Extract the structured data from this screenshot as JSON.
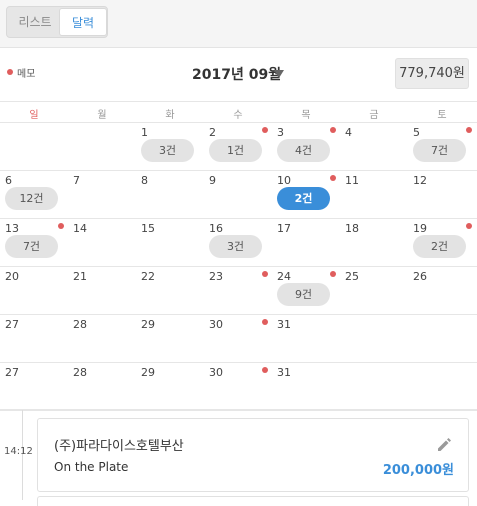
{
  "view_toggle": {
    "list_label": "리스트",
    "calendar_label": "달력"
  },
  "toolbar": {
    "memo_label": "메모",
    "month": "2017년 09월",
    "total": "779,740원",
    "memo_color": "#e05d5d",
    "accent_color": "#3a8ed9"
  },
  "weekdays": [
    "일",
    "월",
    "화",
    "수",
    "목",
    "금",
    "토"
  ],
  "calendar": {
    "weeks": [
      [
        {
          "day": "",
          "dot": false,
          "count": ""
        },
        {
          "day": "",
          "dot": false,
          "count": ""
        },
        {
          "day": "1",
          "dot": false,
          "count": "3건"
        },
        {
          "day": "2",
          "dot": true,
          "count": "1건"
        },
        {
          "day": "3",
          "dot": true,
          "count": "4건"
        },
        {
          "day": "4",
          "dot": false,
          "count": ""
        },
        {
          "day": "5",
          "dot": true,
          "count": "7건"
        }
      ],
      [
        {
          "day": "6",
          "dot": false,
          "count": "12건"
        },
        {
          "day": "7",
          "dot": false,
          "count": ""
        },
        {
          "day": "8",
          "dot": false,
          "count": ""
        },
        {
          "day": "9",
          "dot": false,
          "count": ""
        },
        {
          "day": "10",
          "dot": true,
          "count": "2건",
          "active": true
        },
        {
          "day": "11",
          "dot": false,
          "count": ""
        },
        {
          "day": "12",
          "dot": false,
          "count": ""
        }
      ],
      [
        {
          "day": "13",
          "dot": true,
          "count": "7건"
        },
        {
          "day": "14",
          "dot": false,
          "count": ""
        },
        {
          "day": "15",
          "dot": false,
          "count": ""
        },
        {
          "day": "16",
          "dot": false,
          "count": "3건"
        },
        {
          "day": "17",
          "dot": false,
          "count": ""
        },
        {
          "day": "18",
          "dot": false,
          "count": ""
        },
        {
          "day": "19",
          "dot": true,
          "count": "2건"
        }
      ],
      [
        {
          "day": "20",
          "dot": false,
          "count": ""
        },
        {
          "day": "21",
          "dot": false,
          "count": ""
        },
        {
          "day": "22",
          "dot": false,
          "count": ""
        },
        {
          "day": "23",
          "dot": true,
          "count": ""
        },
        {
          "day": "24",
          "dot": true,
          "count": "9건"
        },
        {
          "day": "25",
          "dot": false,
          "count": ""
        },
        {
          "day": "26",
          "dot": false,
          "count": ""
        }
      ],
      [
        {
          "day": "27",
          "dot": false,
          "count": ""
        },
        {
          "day": "28",
          "dot": false,
          "count": ""
        },
        {
          "day": "29",
          "dot": false,
          "count": ""
        },
        {
          "day": "30",
          "dot": true,
          "count": ""
        },
        {
          "day": "31",
          "dot": false,
          "count": ""
        },
        {
          "day": "",
          "dot": false,
          "count": ""
        },
        {
          "day": "",
          "dot": false,
          "count": ""
        }
      ],
      [
        {
          "day": "27",
          "dot": false,
          "count": ""
        },
        {
          "day": "28",
          "dot": false,
          "count": ""
        },
        {
          "day": "29",
          "dot": false,
          "count": ""
        },
        {
          "day": "30",
          "dot": true,
          "count": ""
        },
        {
          "day": "31",
          "dot": false,
          "count": ""
        },
        {
          "day": "",
          "dot": false,
          "count": ""
        },
        {
          "day": "",
          "dot": false,
          "count": ""
        }
      ]
    ]
  },
  "transactions": [
    {
      "time": "14:12",
      "merchant": "(주)파라다이스호텔부산",
      "memo": "On the Plate",
      "amount": "200,000원",
      "icon": "edit-pencil-icon"
    }
  ]
}
